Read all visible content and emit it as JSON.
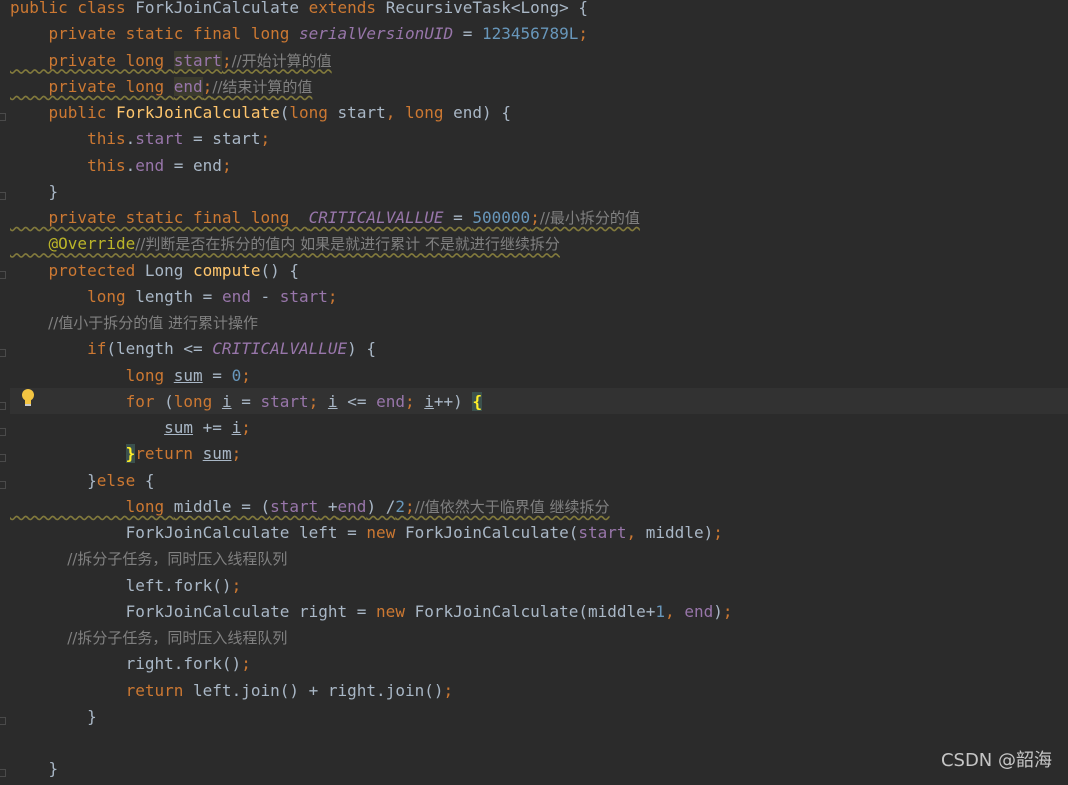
{
  "editor": {
    "theme": "Darcula",
    "colors": {
      "background": "#2b2b2b",
      "keyword": "#cc7832",
      "field": "#9876aa",
      "number": "#6897bb",
      "method": "#ffc66d",
      "comment": "#808080",
      "annotation": "#bbb529",
      "text": "#a9b7c6"
    },
    "gutter_icon": "lightbulb-icon",
    "watermark": "CSDN @韶海"
  },
  "lines": [
    [
      [
        "kw",
        "public class "
      ],
      [
        "t",
        "ForkJoinCalculate "
      ],
      [
        "kw",
        "extends "
      ],
      [
        "t",
        "RecursiveTask<Long> {"
      ]
    ],
    [
      [
        "kw",
        "    private static final long "
      ],
      [
        "fieldi",
        "serialVersionUID"
      ],
      [
        "t",
        " = "
      ],
      [
        "num",
        "123456789L"
      ],
      [
        "kw",
        ";"
      ]
    ],
    [
      [
        "kw",
        "    private long "
      ],
      [
        "field",
        "start"
      ],
      [
        "kw",
        ";"
      ],
      [
        "cmt",
        "//开始计算的值"
      ]
    ],
    [
      [
        "kw",
        "    private long "
      ],
      [
        "field",
        "end"
      ],
      [
        "kw",
        ";"
      ],
      [
        "cmt",
        "//结束计算的值"
      ]
    ],
    [
      [
        "kw",
        "    public "
      ],
      [
        "method",
        "ForkJoinCalculate"
      ],
      [
        "t",
        "("
      ],
      [
        "kw",
        "long "
      ],
      [
        "t",
        "start"
      ],
      [
        "kw",
        ", long "
      ],
      [
        "t",
        "end) {"
      ]
    ],
    [
      [
        "kw",
        "        this"
      ],
      [
        "t",
        "."
      ],
      [
        "field",
        "start"
      ],
      [
        "t",
        " = start"
      ],
      [
        "kw",
        ";"
      ]
    ],
    [
      [
        "kw",
        "        this"
      ],
      [
        "t",
        "."
      ],
      [
        "field",
        "end"
      ],
      [
        "t",
        " = end"
      ],
      [
        "kw",
        ";"
      ]
    ],
    [
      [
        "t",
        "    }"
      ]
    ],
    [
      [
        "kw",
        "    private static final long  "
      ],
      [
        "fieldi",
        "CRITICALVALLUE"
      ],
      [
        "t",
        " = "
      ],
      [
        "num",
        "500000"
      ],
      [
        "kw",
        ";"
      ],
      [
        "cmt",
        "//最小拆分的值"
      ]
    ],
    [
      [
        "ann",
        "    @Override"
      ],
      [
        "cmt",
        "//判断是否在拆分的值内 如果是就进行累计 不是就进行继续拆分"
      ]
    ],
    [
      [
        "kw",
        "    protected "
      ],
      [
        "t",
        "Long "
      ],
      [
        "method",
        "compute"
      ],
      [
        "t",
        "() {"
      ]
    ],
    [
      [
        "kw",
        "        long "
      ],
      [
        "t",
        "length = "
      ],
      [
        "field",
        "end"
      ],
      [
        "t",
        " - "
      ],
      [
        "field",
        "start"
      ],
      [
        "kw",
        ";"
      ]
    ],
    [
      [
        "cmt",
        "        //值小于拆分的值 进行累计操作"
      ]
    ],
    [
      [
        "kw",
        "        if"
      ],
      [
        "t",
        "(length <= "
      ],
      [
        "fieldi",
        "CRITICALVALLUE"
      ],
      [
        "t",
        ") {"
      ]
    ],
    [
      [
        "kw",
        "            long "
      ],
      [
        "ul",
        "sum"
      ],
      [
        "t",
        " = "
      ],
      [
        "num",
        "0"
      ],
      [
        "kw",
        ";"
      ]
    ],
    [
      [
        "kw",
        "            for "
      ],
      [
        "t",
        "("
      ],
      [
        "kw",
        "long "
      ],
      [
        "ul",
        "i"
      ],
      [
        "t",
        " = "
      ],
      [
        "field",
        "start"
      ],
      [
        "kw",
        "; "
      ],
      [
        "ul",
        "i"
      ],
      [
        "t",
        " <= "
      ],
      [
        "field",
        "end"
      ],
      [
        "kw",
        "; "
      ],
      [
        "ul",
        "i"
      ],
      [
        "t",
        "++) "
      ],
      [
        "brace",
        "{"
      ]
    ],
    [
      [
        "t",
        "                "
      ],
      [
        "ul",
        "sum"
      ],
      [
        "t",
        " += "
      ],
      [
        "ul",
        "i"
      ],
      [
        "kw",
        ";"
      ]
    ],
    [
      [
        "t",
        "            "
      ],
      [
        "brace",
        "}"
      ],
      [
        "kw",
        "return "
      ],
      [
        "ul",
        "sum"
      ],
      [
        "kw",
        ";"
      ]
    ],
    [
      [
        "t",
        "        }"
      ],
      [
        "kw",
        "else "
      ],
      [
        "t",
        "{"
      ]
    ],
    [
      [
        "kw",
        "            long "
      ],
      [
        "t",
        "middle = ("
      ],
      [
        "field",
        "start"
      ],
      [
        "t",
        " +"
      ],
      [
        "field",
        "end"
      ],
      [
        "t",
        ") /"
      ],
      [
        "num",
        "2"
      ],
      [
        "kw",
        ";"
      ],
      [
        "cmt",
        "//值依然大于临界值 继续拆分"
      ]
    ],
    [
      [
        "t",
        "            ForkJoinCalculate left = "
      ],
      [
        "kw",
        "new "
      ],
      [
        "t",
        "ForkJoinCalculate("
      ],
      [
        "field",
        "start"
      ],
      [
        "kw",
        ", "
      ],
      [
        "t",
        "middle)"
      ],
      [
        "kw",
        ";"
      ]
    ],
    [
      [
        "cmt",
        "            //拆分子任务，同时压入线程队列"
      ]
    ],
    [
      [
        "t",
        "            left.fork()"
      ],
      [
        "kw",
        ";"
      ]
    ],
    [
      [
        "t",
        "            ForkJoinCalculate right = "
      ],
      [
        "kw",
        "new "
      ],
      [
        "t",
        "ForkJoinCalculate(middle+"
      ],
      [
        "num",
        "1"
      ],
      [
        "kw",
        ", "
      ],
      [
        "field",
        "end"
      ],
      [
        "t",
        ")"
      ],
      [
        "kw",
        ";"
      ]
    ],
    [
      [
        "cmt",
        "            //拆分子任务，同时压入线程队列"
      ]
    ],
    [
      [
        "t",
        "            right.fork()"
      ],
      [
        "kw",
        ";"
      ]
    ],
    [
      [
        "kw",
        "            return "
      ],
      [
        "t",
        "left.join() + right.join()"
      ],
      [
        "kw",
        ";"
      ]
    ],
    [
      [
        "t",
        "        }"
      ]
    ],
    [
      [
        "t",
        ""
      ]
    ],
    [
      [
        "t",
        "    }"
      ]
    ]
  ]
}
